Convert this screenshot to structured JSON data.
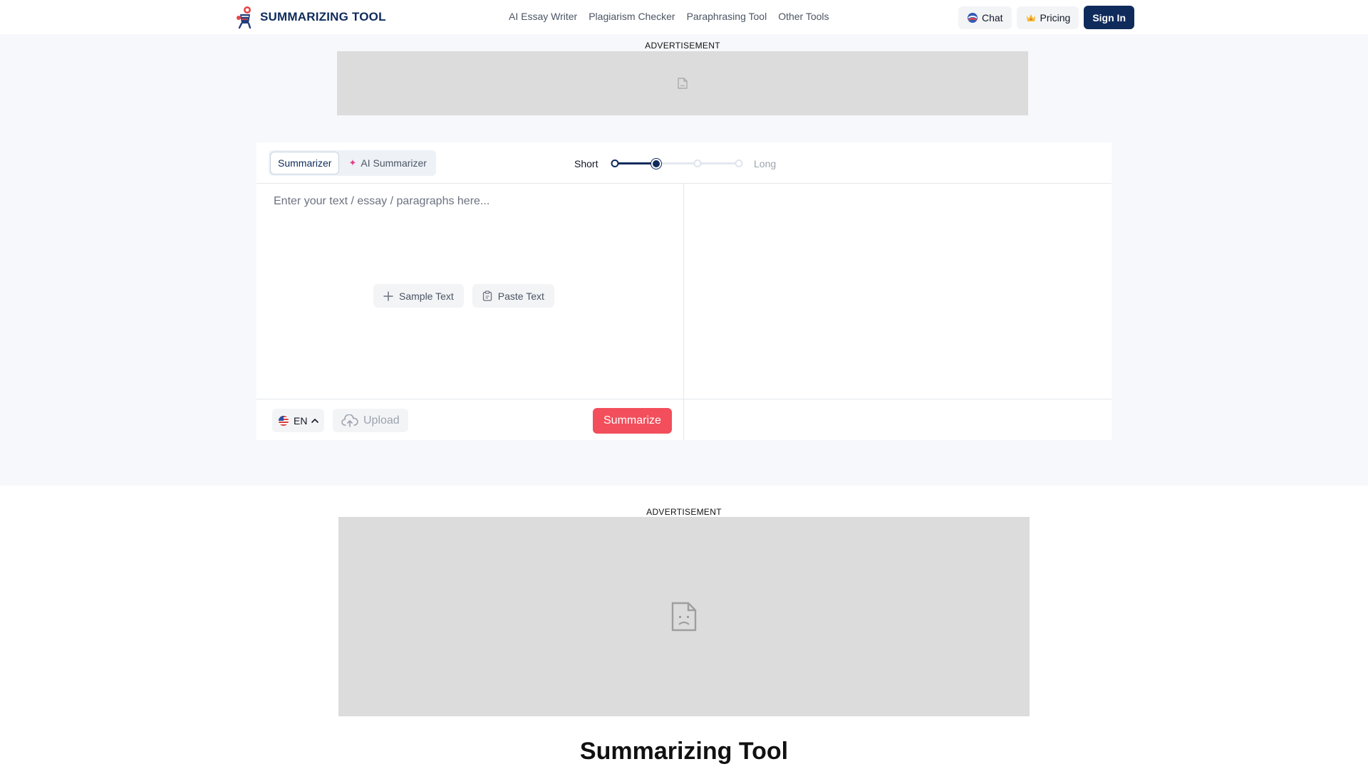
{
  "brand": {
    "name": "SUMMARIZING TOOL",
    "logo_icon": "mascot-logo-icon"
  },
  "nav": {
    "links": [
      {
        "label": "AI Essay Writer"
      },
      {
        "label": "Plagiarism Checker"
      },
      {
        "label": "Paraphrasing Tool"
      },
      {
        "label": "Other Tools"
      }
    ]
  },
  "header_actions": {
    "chat_label": "Chat",
    "chat_icon": "chat-brand-icon",
    "pricing_label": "Pricing",
    "pricing_icon": "crown-icon",
    "signin_label": "Sign In"
  },
  "ads": {
    "top_label": "ADVERTISEMENT",
    "bottom_label": "ADVERTISEMENT",
    "placeholder_icon": "broken-document-icon"
  },
  "tool": {
    "tabs": [
      {
        "label": "Summarizer",
        "active": true
      },
      {
        "label": "AI Summarizer",
        "active": false,
        "icon": "sparkle-icon"
      }
    ],
    "length": {
      "min_label": "Short",
      "max_label": "Long",
      "stops": 4,
      "selected_stop": 2
    },
    "input": {
      "placeholder": "Enter your text / essay / paragraphs here...",
      "value": ""
    },
    "sample_button": "Sample Text",
    "paste_button": "Paste Text",
    "language": {
      "code": "EN",
      "flag_icon": "us-flag-icon"
    },
    "upload_button": "Upload",
    "summarize_button": "Summarize"
  },
  "page_title": "Summarizing Tool",
  "colors": {
    "brand_navy": "#0f2b5b",
    "summarize_red": "#f24e5b",
    "hero_background": "#f6f8fb",
    "ad_gray": "#dcdcdc"
  }
}
